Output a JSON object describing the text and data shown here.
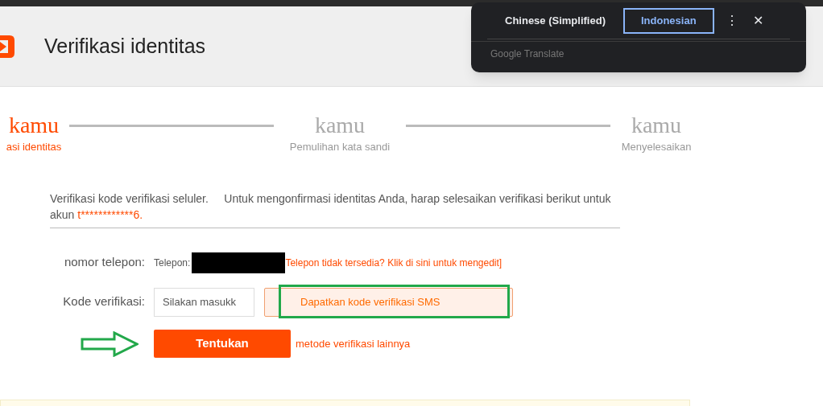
{
  "header": {
    "title": "Verifikasi identitas"
  },
  "steps": [
    {
      "title": "kamu",
      "label": "asi identitas",
      "current": true
    },
    {
      "title": "kamu",
      "label": "Pemulihan kata sandi",
      "current": false
    },
    {
      "title": "kamu",
      "label": "Menyelesaikan",
      "current": false
    }
  ],
  "intro": {
    "text": "Verifikasi kode verifikasi seluler.     Untuk mengonfirmasi identitas Anda, harap selesaikan verifikasi berikut untuk akun",
    "account": "t************6."
  },
  "phone": {
    "label": "nomor telepon:",
    "prefix": "Telepon:",
    "link": "Telepon tidak tersedia? Klik di sini untuk mengedit]"
  },
  "code": {
    "label": "Kode verifikasi:",
    "placeholder": "Silakan masukk",
    "sms_button": "Dapatkan kode verifikasi SMS"
  },
  "submit": {
    "button": "Tentukan",
    "other_link": "metode verifikasi lainnya"
  },
  "translate_popup": {
    "languages": [
      {
        "label": "Chinese (Simplified)",
        "selected": false
      },
      {
        "label": "Indonesian",
        "selected": true
      }
    ],
    "menu": "⋮",
    "close": "✕",
    "footer": "Google Translate"
  }
}
